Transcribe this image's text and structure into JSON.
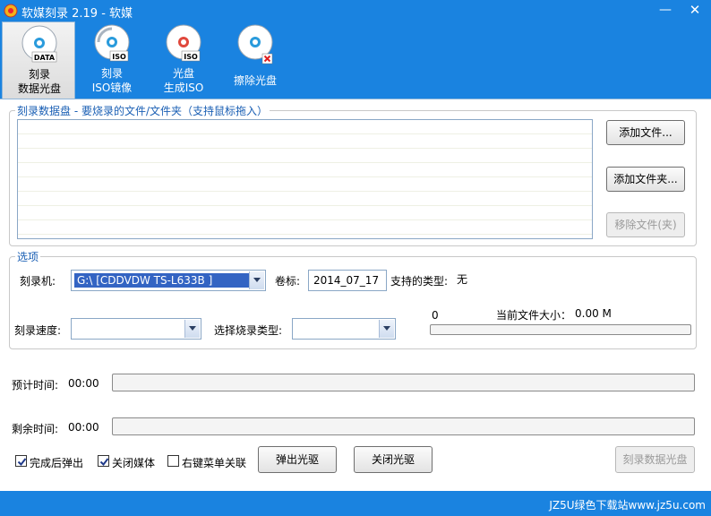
{
  "window": {
    "title": "软媒刻录 2.19 - 软媒",
    "minimize_glyph": "—",
    "close_glyph": "✕"
  },
  "toolbar": {
    "items": [
      {
        "line1": "刻录",
        "line2": "数据光盘",
        "disc_label": "DATA",
        "icon": "disc-data-icon",
        "active": true
      },
      {
        "line1": "刻录",
        "line2": "ISO镜像",
        "disc_label": "ISO",
        "icon": "disc-iso-burn-icon",
        "active": false
      },
      {
        "line1": "光盘",
        "line2": "生成ISO",
        "disc_label": "ISO",
        "icon": "disc-make-iso-icon",
        "active": false
      },
      {
        "line1": "擦除光盘",
        "line2": "",
        "disc_label": "",
        "icon": "disc-erase-icon",
        "active": false
      }
    ]
  },
  "files_group": {
    "legend": "刻录数据盘 - 要烧录的文件/文件夹（支持鼠标拖入）",
    "add_file": "添加文件...",
    "add_folder": "添加文件夹...",
    "remove_file": "移除文件(夹)"
  },
  "options_group": {
    "legend": "选项",
    "burner_label": "刻录机:",
    "burner_value": "G:\\ [CDDVDW TS-L633B ]",
    "volume_label": "卷标:",
    "volume_value": "2014_07_17",
    "supported_label": "支持的类型:",
    "supported_value": "无",
    "speed_label": "刻录速度:",
    "speed_value": "",
    "burn_type_label": "选择烧录类型:",
    "burn_type_value": "",
    "progress_start": "0",
    "file_size_label": "当前文件大小：",
    "file_size_value": "0.00 M",
    "file_progress": 0
  },
  "timing": {
    "estimated_label": "预计时间:",
    "estimated_value": "00:00",
    "estimated_progress": 0,
    "remaining_label": "剩余时间:",
    "remaining_value": "00:00",
    "remaining_progress": 0
  },
  "bottom": {
    "eject_after": {
      "label": "完成后弹出",
      "checked": true
    },
    "close_media": {
      "label": "关闭媒体",
      "checked": true
    },
    "context_menu": {
      "label": "右键菜单关联",
      "checked": false
    },
    "eject_button": "弹出光驱",
    "close_drive_button": "关闭光驱",
    "burn_button": "刻录数据光盘"
  },
  "status": {
    "watermark": "JZ5U绿色下载站www.jz5u.com"
  },
  "colors": {
    "accent": "#1a83e0",
    "legend": "#1a5fb4",
    "selection": "#3364c3",
    "progress": "#3fb33f"
  }
}
